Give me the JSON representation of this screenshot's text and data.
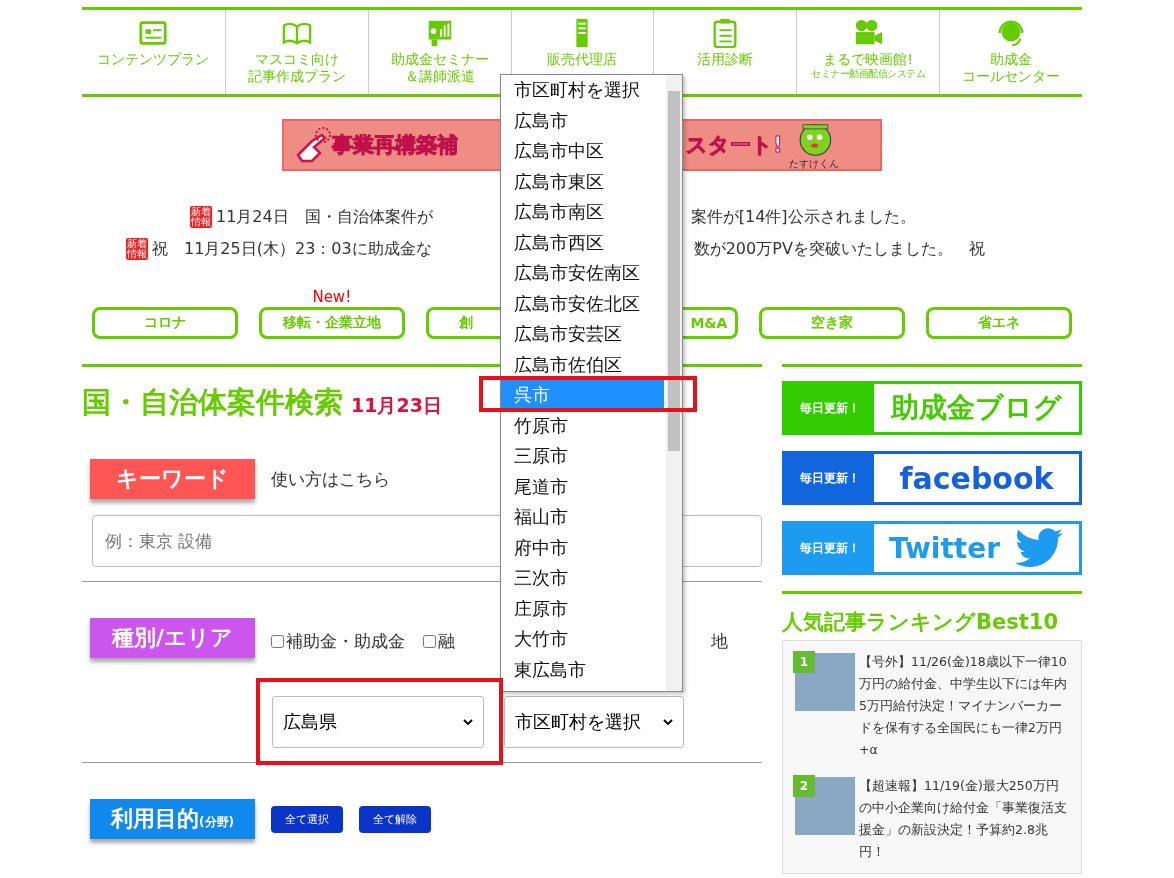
{
  "nav": [
    {
      "lines": [
        "コンテンツプラン"
      ],
      "kind": "screen"
    },
    {
      "lines": [
        "マスコミ向け",
        "記事作成プラン"
      ],
      "kind": "book"
    },
    {
      "lines": [
        "助成金セミナー",
        "＆講師派遣"
      ],
      "kind": "board"
    },
    {
      "lines": [
        "販売代理店"
      ],
      "kind": "tower"
    },
    {
      "lines": [
        "活用診断"
      ],
      "kind": "clipboard"
    },
    {
      "lines": [
        "まるで映画館!"
      ],
      "sub": "セミナー動画配信システム",
      "kind": "camera"
    },
    {
      "lines": [
        "助成金",
        "コールセンター"
      ],
      "kind": "headset"
    }
  ],
  "banner": {
    "left": "事業再構築補",
    "right": "スタート!",
    "mascot": "たすけくん"
  },
  "news": [
    {
      "badge": [
        "新着",
        "情報"
      ],
      "left": "11月24日　国・自治体案件が",
      "right": "案件が[14件]公示されました。"
    },
    {
      "badge": [
        "新着",
        "情報"
      ],
      "left": "祝　11月25日(木）23：03に助成金な",
      "right": "数が200万PVを突破いたしました。　祝"
    }
  ],
  "categories": [
    {
      "label": "コロナ",
      "kind": "full"
    },
    {
      "label": "移転・企業立地",
      "new": "New!",
      "kind": "full"
    },
    {
      "label": "創",
      "kind": "cut_right"
    },
    {
      "label": "M&A",
      "kind": "cut_left"
    },
    {
      "label": "空き家",
      "kind": "full"
    },
    {
      "label": "省エネ",
      "kind": "full"
    }
  ],
  "search": {
    "title": "国・自治体案件検索",
    "date": "11月23日",
    "keyword": {
      "tag": "キーワード",
      "help": "使い方はこちら",
      "placeholder": "例：東京 設備"
    },
    "area": {
      "tag": "種別/エリア",
      "checks": [
        {
          "label": "補助金・助成金",
          "checked": false
        },
        {
          "label": "融",
          "checked": false
        }
      ],
      "tail": "地",
      "prefecture": "広島県",
      "city": "市区町村を選択"
    },
    "purpose": {
      "tag": "利用目的",
      "tag_small": "(分野)",
      "buttons": [
        "全て選択",
        "全て解除"
      ]
    }
  },
  "dropdown": {
    "options": [
      {
        "label": "市区町村を選択",
        "selected": false
      },
      {
        "label": "広島市",
        "selected": false
      },
      {
        "label": "広島市中区",
        "selected": false
      },
      {
        "label": "広島市東区",
        "selected": false
      },
      {
        "label": "広島市南区",
        "selected": false
      },
      {
        "label": "広島市西区",
        "selected": false
      },
      {
        "label": "広島市安佐南区",
        "selected": false
      },
      {
        "label": "広島市安佐北区",
        "selected": false
      },
      {
        "label": "広島市安芸区",
        "selected": false
      },
      {
        "label": "広島市佐伯区",
        "selected": false
      },
      {
        "label": "呉市",
        "selected": true
      },
      {
        "label": "竹原市",
        "selected": false
      },
      {
        "label": "三原市",
        "selected": false
      },
      {
        "label": "尾道市",
        "selected": false
      },
      {
        "label": "福山市",
        "selected": false
      },
      {
        "label": "府中市",
        "selected": false
      },
      {
        "label": "三次市",
        "selected": false
      },
      {
        "label": "庄原市",
        "selected": false
      },
      {
        "label": "大竹市",
        "selected": false
      },
      {
        "label": "東広島市",
        "selected": false
      }
    ]
  },
  "sidebar": {
    "banners": [
      {
        "tag": "毎日更新！",
        "label": "助成金ブログ",
        "color": "#33cc00",
        "kind": "blog"
      },
      {
        "tag": "毎日更新！",
        "label": "facebook",
        "color": "#1166dd",
        "kind": "facebook"
      },
      {
        "tag": "毎日更新！",
        "label": "Twitter",
        "color": "#1d9bf0",
        "kind": "twitter"
      }
    ],
    "ranking_title": "人気記事ランキングBest10",
    "ranking": [
      {
        "rank": "1",
        "text": "【号外】11/26(金)18歳以下一律10万円の給付金、中学生以下には年内5万円給付決定！マイナンバーカードを保有する全国民にも一律2万円+α"
      },
      {
        "rank": "2",
        "text": "【超速報】11/19(金)最大250万円の中小企業向け給付金「事業復活支援金」の新設決定！予算約2.8兆円！"
      }
    ]
  }
}
